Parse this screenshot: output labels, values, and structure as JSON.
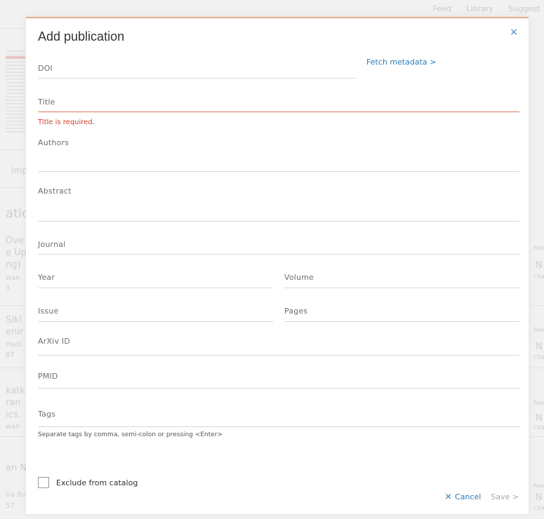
{
  "background": {
    "nav": [
      "Feed",
      "Library",
      "Suggest"
    ],
    "fragments": [
      "Imp",
      "atio",
      "Ove",
      "e Up",
      "ng)",
      "wan",
      "3",
      "Sikl",
      "enir",
      "Hadi",
      "87",
      "katk",
      "ran",
      "ics,",
      "wan",
      "an N",
      "tia Bu",
      "57"
    ],
    "right_fragments": [
      "Rea",
      "N",
      "Cita",
      "Rea",
      "N",
      "Cita",
      "Rea",
      "N",
      "Cita",
      "Rea",
      "N",
      "Cita"
    ]
  },
  "modal": {
    "title": "Add publication",
    "close_icon": "×",
    "fetch_label": "Fetch metadata >",
    "fields": {
      "doi": "DOI",
      "title": "Title",
      "title_error": "Title is required.",
      "authors": "Authors",
      "abstract": "Abstract",
      "journal": "Journal",
      "year": "Year",
      "volume": "Volume",
      "issue": "Issue",
      "pages": "Pages",
      "arxiv": "ArXiv ID",
      "pmid": "PMID",
      "tags": "Tags",
      "tags_hint": "Separate tags by comma, semi-colon or pressing <Enter>"
    },
    "exclude_label": "Exclude from catalog",
    "cancel_label": "Cancel",
    "save_label": "Save >"
  },
  "colors": {
    "link": "#2d7bb5",
    "error": "#d13b2a",
    "accent_top": "#e8a98a"
  }
}
